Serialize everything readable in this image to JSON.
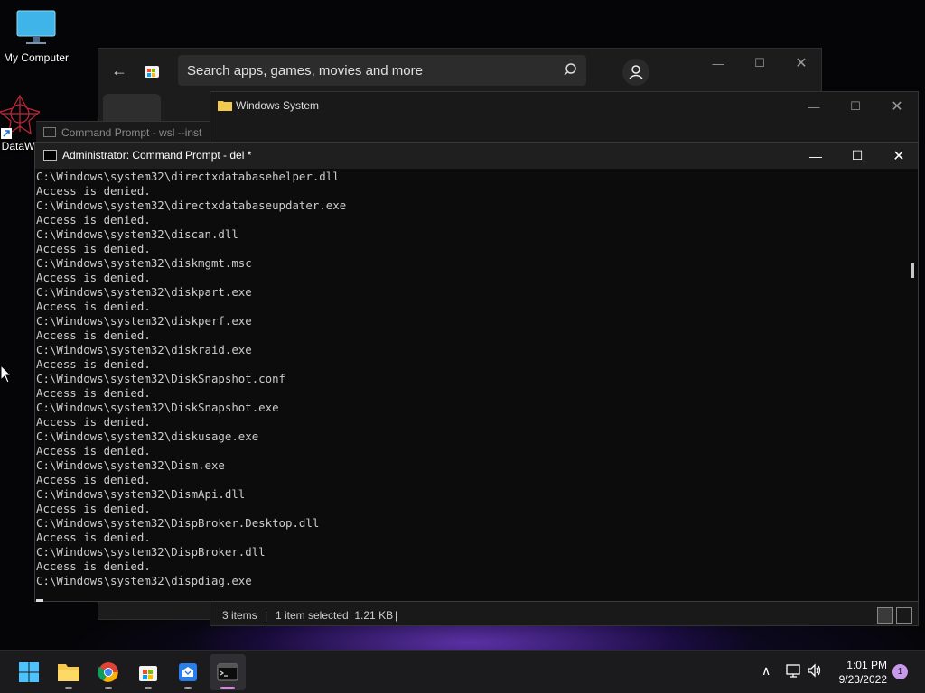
{
  "desktop": {
    "icons": [
      {
        "label": "My Computer",
        "icon": "monitor-icon"
      },
      {
        "label": "DataW",
        "icon": "datawrangler-icon"
      }
    ]
  },
  "store": {
    "search_placeholder": "Search apps, games, movies and more"
  },
  "explorer": {
    "title": "Windows System",
    "status_items": "3 items",
    "status_selected": "1 item selected  1.21 KB",
    "separator": "|"
  },
  "wsl": {
    "title": "Command Prompt - wsl  --inst"
  },
  "cmd": {
    "title": "Administrator: Command Prompt - del  *",
    "lines": [
      "C:\\Windows\\system32\\directxdatabasehelper.dll",
      "Access is denied.",
      "C:\\Windows\\system32\\directxdatabaseupdater.exe",
      "Access is denied.",
      "C:\\Windows\\system32\\discan.dll",
      "Access is denied.",
      "C:\\Windows\\system32\\diskmgmt.msc",
      "Access is denied.",
      "C:\\Windows\\system32\\diskpart.exe",
      "Access is denied.",
      "C:\\Windows\\system32\\diskperf.exe",
      "Access is denied.",
      "C:\\Windows\\system32\\diskraid.exe",
      "Access is denied.",
      "C:\\Windows\\system32\\DiskSnapshot.conf",
      "Access is denied.",
      "C:\\Windows\\system32\\DiskSnapshot.exe",
      "Access is denied.",
      "C:\\Windows\\system32\\diskusage.exe",
      "Access is denied.",
      "C:\\Windows\\system32\\Dism.exe",
      "Access is denied.",
      "C:\\Windows\\system32\\DismApi.dll",
      "Access is denied.",
      "C:\\Windows\\system32\\DispBroker.Desktop.dll",
      "Access is denied.",
      "C:\\Windows\\system32\\DispBroker.dll",
      "Access is denied.",
      "C:\\Windows\\system32\\dispdiag.exe"
    ]
  },
  "taskbar": {
    "apps": [
      "windows-start-icon",
      "file-explorer-icon",
      "chrome-icon",
      "microsoft-store-icon",
      "app-installer-icon",
      "terminal-icon"
    ],
    "time": "1:01 PM",
    "date": "9/23/2022",
    "notification_count": "1"
  },
  "colors": {
    "accent_pink": "#d38bd6",
    "console_text": "#cccccc"
  }
}
